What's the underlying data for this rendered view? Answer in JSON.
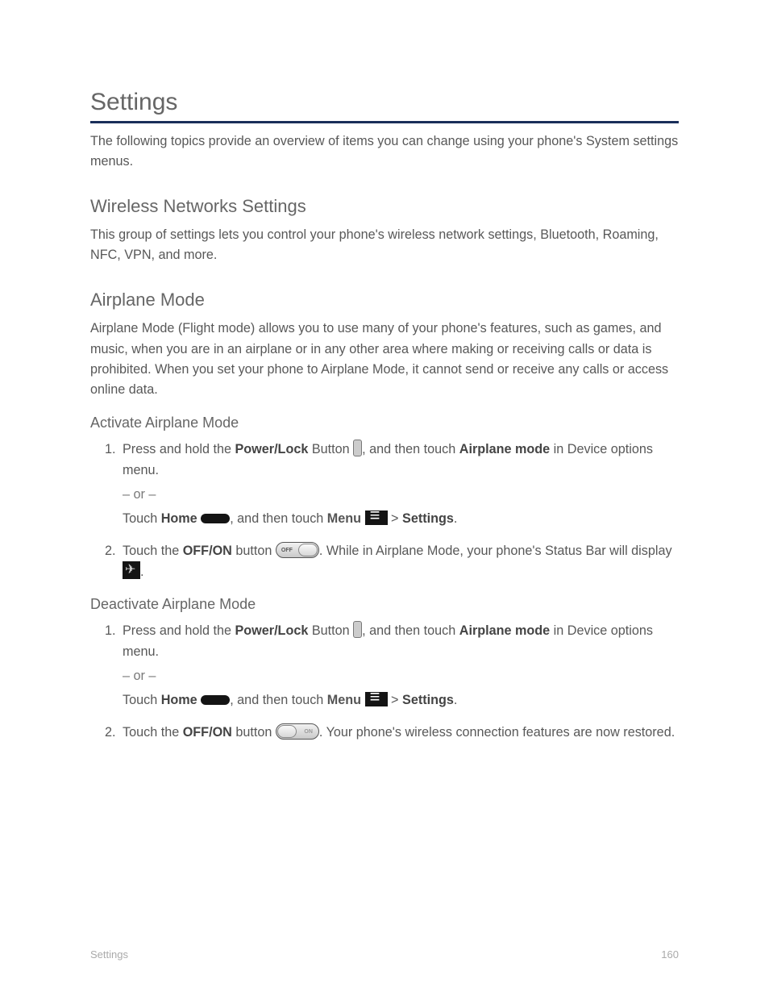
{
  "page_title": "Settings",
  "intro": "The following topics provide an overview of items you can change using your phone's System settings menus.",
  "section1": {
    "title": "Wireless Networks Settings",
    "intro": "This group of settings lets you control your phone's wireless network settings, Bluetooth, Roaming, NFC, VPN, and more."
  },
  "airplane": {
    "title": "Airplane Mode",
    "intro": "Airplane Mode (Flight mode) allows you to use many of your phone's features, such as games, and music, when you are in an airplane or in any other area where making or receiving calls or data is prohibited. When you set your phone to Airplane Mode, it cannot send or receive any calls or access online data.",
    "activate_heading": "Activate Airplane Mode",
    "step1_a": "1.",
    "step1_b": "Press and hold the ",
    "step1_c": "Power/Lock",
    "step1_d": " Button ",
    "step1_e": ", and then touch ",
    "step1_f": "Airplane mode",
    "step1_g": " in Device options menu.",
    "or": "– or –",
    "step_alt_a": "Touch ",
    "step_alt_home": "Home",
    "step_alt_b": ", and then touch ",
    "step_alt_menu": "Menu",
    "step_alt_c": " > ",
    "step_alt_settings": "Settings",
    "step_alt_d": ".",
    "step2_a": "2.",
    "step2_b": "Touch the ",
    "step2_c": "OFF/ON",
    "step2_d": " button ",
    "step2_e": ". While in Airplane Mode, your phone's Status Bar will display ",
    "step2_f": ".",
    "deactivate_heading": "Deactivate Airplane Mode",
    "dstep2_e": ". Your phone's wireless connection features are now restored."
  },
  "footer_left": "Settings",
  "footer_right": "160"
}
